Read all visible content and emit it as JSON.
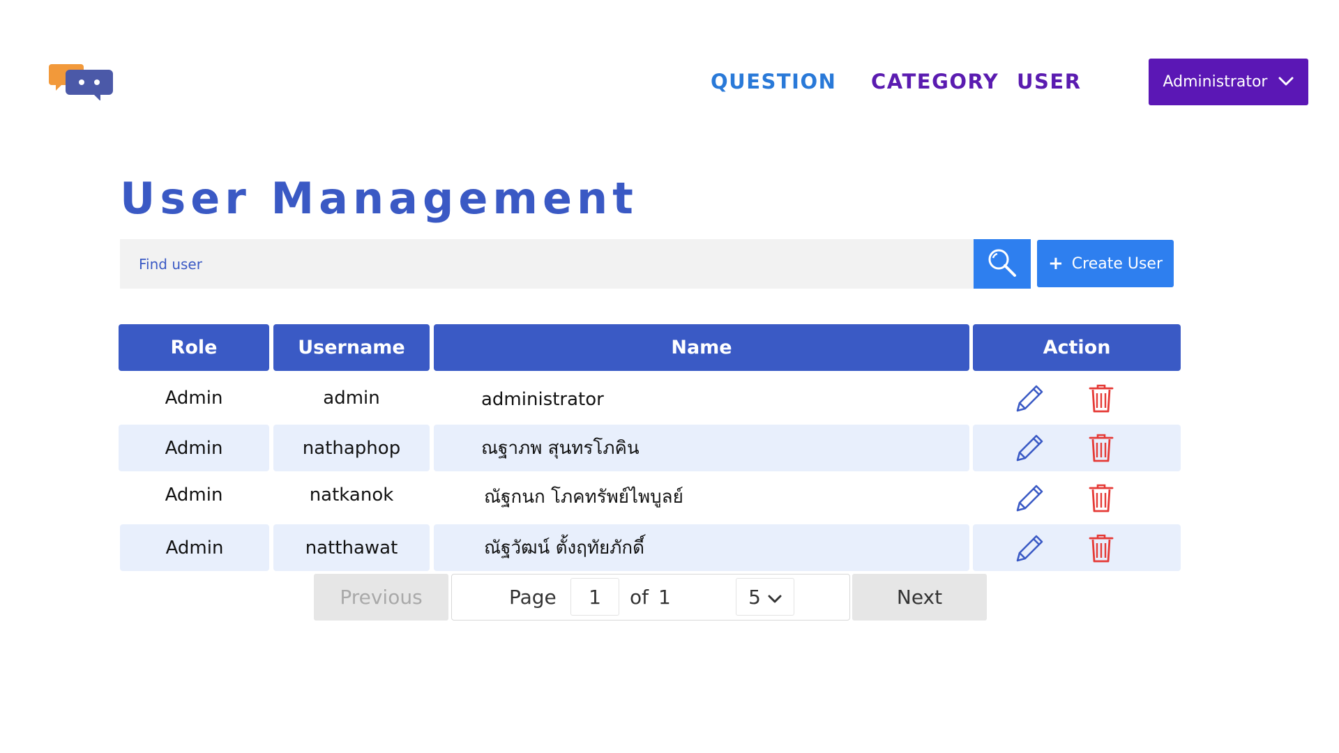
{
  "header": {
    "nav": {
      "question": "QUESTION",
      "category": "CATEGORY",
      "user": "USER"
    },
    "admin_menu_label": "Administrator",
    "colors": {
      "primary_purple": "#5b17b5",
      "nav_blue": "#2979d8",
      "accent_blue": "#2e7fef"
    }
  },
  "page_title": "User Management",
  "search": {
    "placeholder": "Find user",
    "value": "",
    "button_icon": "search-icon"
  },
  "create_button": {
    "icon": "plus-icon",
    "label": "Create User"
  },
  "table": {
    "headers": {
      "role": "Role",
      "username": "Username",
      "name": "Name",
      "action": "Action"
    },
    "rows": [
      {
        "role": "Admin",
        "username": "admin",
        "name": "administrator"
      },
      {
        "role": "Admin",
        "username": "nathaphop",
        "name": "ณฐาภพ สุนทรโภคิน"
      },
      {
        "role": "Admin",
        "username": "natkanok",
        "name": "ณัฐกนก โภคทรัพย์ไพบูลย์"
      },
      {
        "role": "Admin",
        "username": "natthawat",
        "name": "ณัฐวัฒน์ ตั้งฤทัยภักดี์"
      }
    ],
    "row_actions": [
      "edit-icon",
      "delete-icon"
    ]
  },
  "pagination": {
    "previous_label": "Previous",
    "page_label": "Page",
    "current_page": "1",
    "of_label": "of",
    "total_pages": "1",
    "page_size": "5",
    "next_label": "Next"
  }
}
